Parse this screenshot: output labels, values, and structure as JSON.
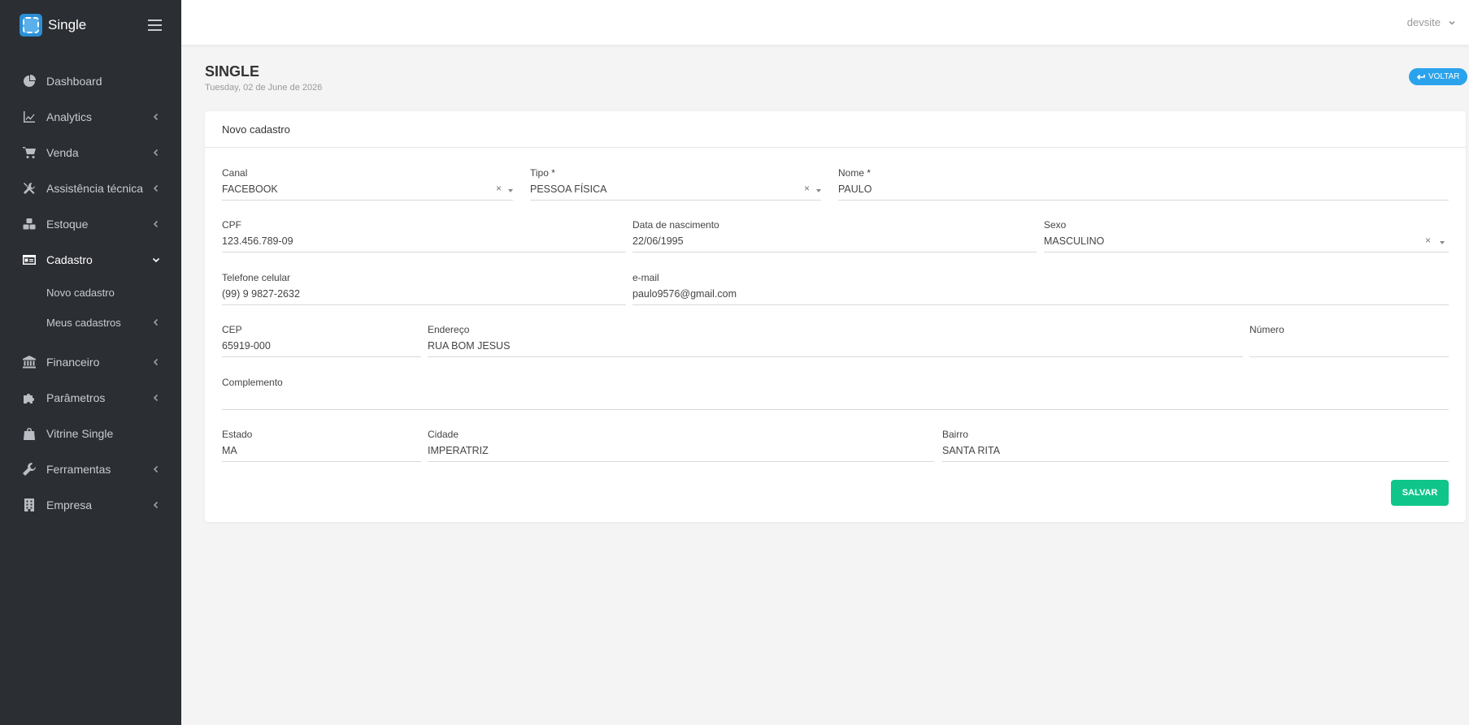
{
  "brand": {
    "name": "Single"
  },
  "sidebar": {
    "items": [
      {
        "label": "Dashboard",
        "icon": "dashboard-icon"
      },
      {
        "label": "Analytics",
        "icon": "chart-line-icon"
      },
      {
        "label": "Venda",
        "icon": "cart-icon"
      },
      {
        "label": "Assistência técnica",
        "icon": "tools-icon"
      },
      {
        "label": "Estoque",
        "icon": "boxes-icon"
      },
      {
        "label": "Cadastro",
        "icon": "id-card-icon"
      },
      {
        "label": "Novo cadastro"
      },
      {
        "label": "Meus cadastros"
      },
      {
        "label": "Financeiro",
        "icon": "bank-icon"
      },
      {
        "label": "Parâmetros",
        "icon": "puzzle-icon"
      },
      {
        "label": "Vitrine Single",
        "icon": "shopping-bag-icon"
      },
      {
        "label": "Ferramentas",
        "icon": "wrench-icon"
      },
      {
        "label": "Empresa",
        "icon": "building-icon"
      }
    ]
  },
  "topbar": {
    "user": "devsite"
  },
  "page": {
    "title": "SINGLE",
    "date": "Tuesday, 02 de June de 2026",
    "back_label": "VOLTAR"
  },
  "form": {
    "card_title": "Novo cadastro",
    "canal": {
      "label": "Canal",
      "value": "FACEBOOK"
    },
    "tipo": {
      "label": "Tipo *",
      "value": "PESSOA FÍSICA"
    },
    "nome": {
      "label": "Nome *",
      "value": "PAULO"
    },
    "cpf": {
      "label": "CPF",
      "value": "123.456.789-09"
    },
    "nascimento": {
      "label": "Data de nascimento",
      "value": "22/06/1995"
    },
    "sexo": {
      "label": "Sexo",
      "value": "MASCULINO"
    },
    "telefone": {
      "label": "Telefone celular",
      "value": "(99) 9 9827-2632"
    },
    "email": {
      "label": "e-mail",
      "value": "paulo9576@gmail.com"
    },
    "cep": {
      "label": "CEP",
      "value": "65919-000"
    },
    "endereco": {
      "label": "Endereço",
      "value": "RUA BOM JESUS"
    },
    "numero": {
      "label": "Número",
      "value": ""
    },
    "complemento": {
      "label": "Complemento",
      "value": ""
    },
    "estado": {
      "label": "Estado",
      "value": "MA"
    },
    "cidade": {
      "label": "Cidade",
      "value": "IMPERATRIZ"
    },
    "bairro": {
      "label": "Bairro",
      "value": "SANTA RITA"
    },
    "clear_symbol": "×",
    "save_label": "SALVAR"
  },
  "colors": {
    "sidebar_bg": "#2b2e33",
    "accent_blue": "#2ba3ec",
    "save_green": "#10c58a"
  }
}
